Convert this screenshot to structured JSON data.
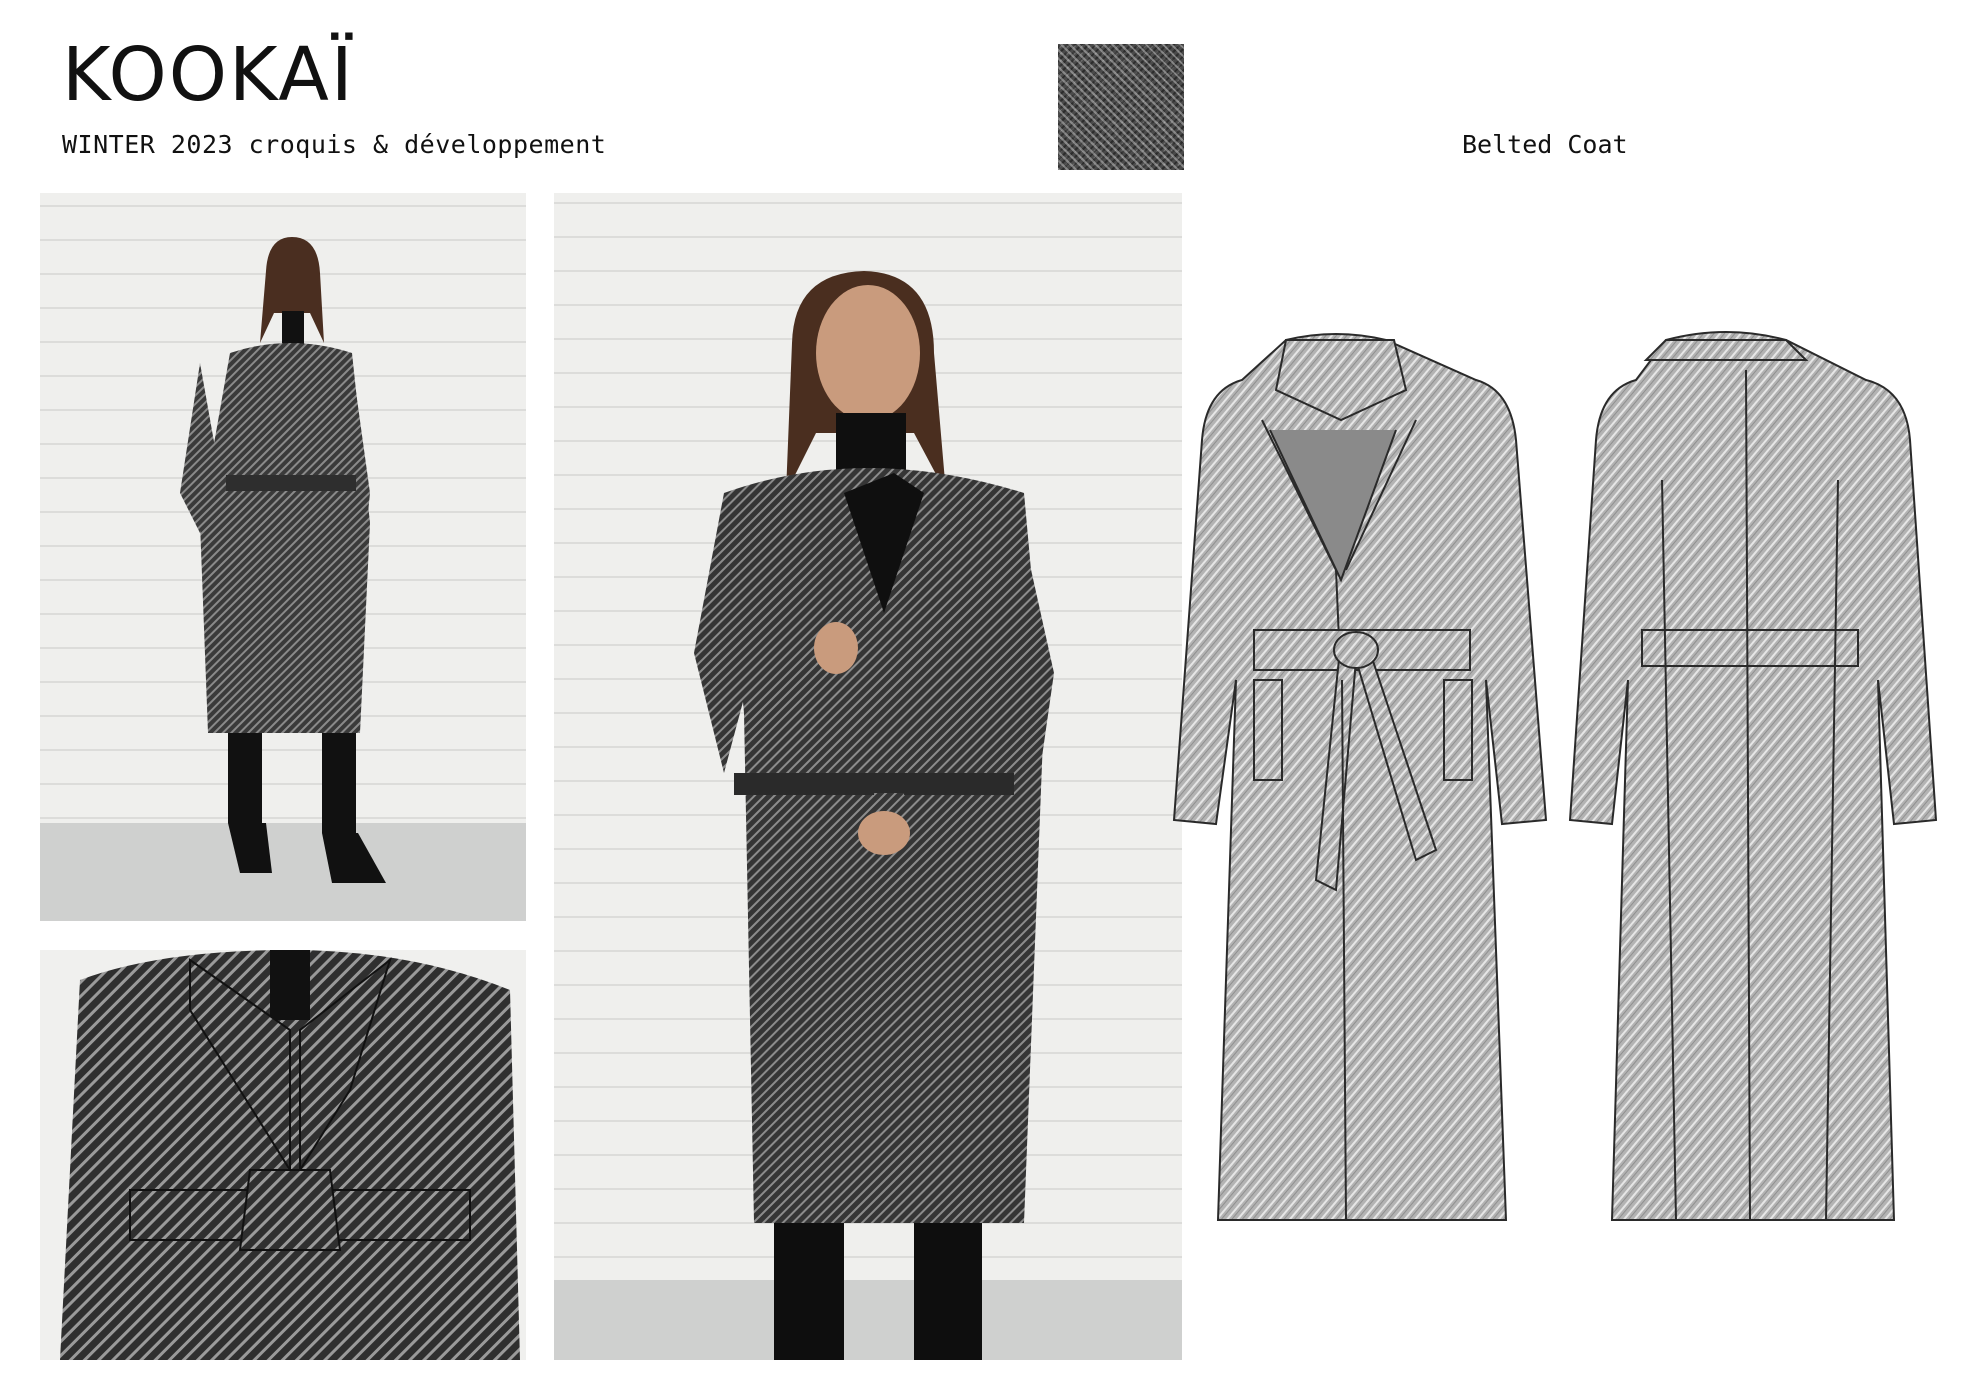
{
  "brand": {
    "logo": "KOOKAÏ"
  },
  "header": {
    "collection": "WINTER 2023 croquis & développement",
    "product_name": "Belted Coat"
  },
  "swatch": {
    "fabric_icon": "herringbone-tweed-swatch",
    "color": "#3d3d3d"
  },
  "photos": [
    {
      "id": "full-look",
      "icon": "model-photo"
    },
    {
      "id": "detail",
      "icon": "detail-photo"
    },
    {
      "id": "main",
      "icon": "model-photo"
    }
  ],
  "sketches": {
    "views": [
      "front",
      "back"
    ],
    "fill": "#bdbdbd",
    "stroke": "#2a2a2a"
  }
}
